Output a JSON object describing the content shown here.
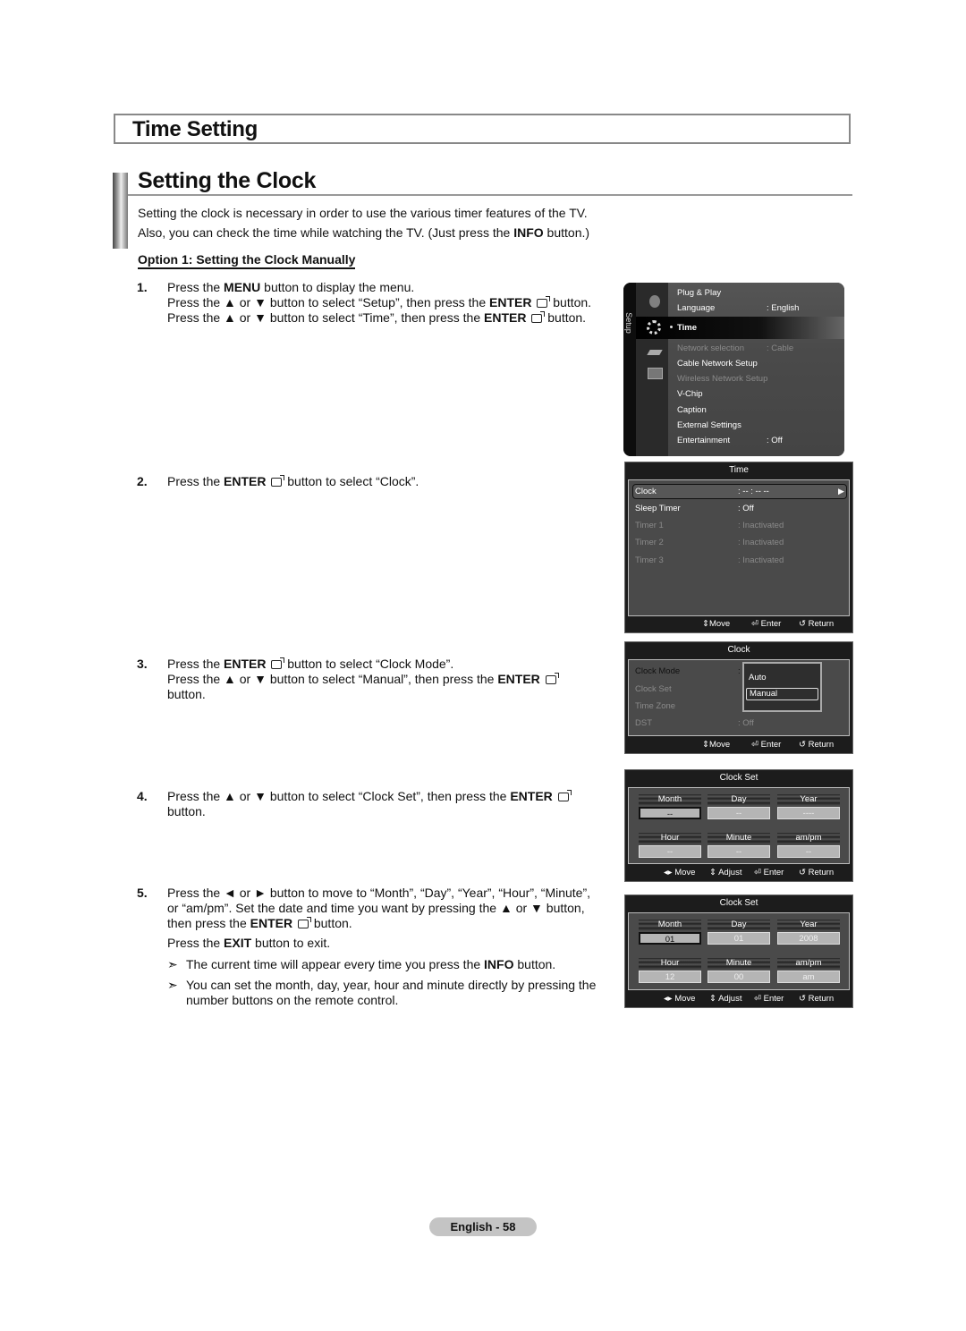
{
  "section_title": "Time Setting",
  "subsection_title": "Setting the Clock",
  "intro": [
    "Setting the clock is necessary in order to use the various timer features of the TV.",
    "Also, you can check the time while watching the TV. (Just press the INFO button.)"
  ],
  "option_heading": "Option 1: Setting the Clock Manually",
  "steps": [
    {
      "num": "1.",
      "lines": [
        "Press the MENU button to display the menu.",
        "Press the ▲ or ▼ button to select “Setup”, then press the ENTER button.",
        "Press the ▲ or ▼ button to select “Time”, then press the ENTER button."
      ]
    },
    {
      "num": "2.",
      "lines": [
        "Press the ENTER button to select “Clock”."
      ]
    },
    {
      "num": "3.",
      "lines": [
        "Press the ENTER button to select “Clock Mode”.",
        "Press the ▲ or ▼ button to select “Manual”, then press the ENTER",
        "button."
      ]
    },
    {
      "num": "4.",
      "lines": [
        "Press the ▲ or ▼ button to select “Clock Set”, then press the ENTER",
        "button."
      ]
    },
    {
      "num": "5.",
      "lines": [
        "Press the ◄ or ► button to move to “Month”, “Day”, “Year”, “Hour”, “Minute”,",
        "or “am/pm”. Set the date and time you want by pressing the ▲ or ▼ button,",
        "then press the ENTER button.",
        "Press the EXIT button to exit."
      ]
    }
  ],
  "notes": [
    "The current time will appear every time you press the INFO button.",
    "You can set the month, day, year, hour and minute directly by pressing the number buttons on the remote control."
  ],
  "setup_menu": {
    "side_label": "Setup",
    "items": [
      {
        "label": "Plug & Play",
        "value": "",
        "state": "normal"
      },
      {
        "label": "Language",
        "value": ": English",
        "state": "normal"
      },
      {
        "label": "Time",
        "value": "",
        "state": "selected"
      },
      {
        "label": "Network selection",
        "value": ": Cable",
        "state": "dim"
      },
      {
        "label": "Cable Network Setup",
        "value": "",
        "state": "normal"
      },
      {
        "label": "Wireless Network Setup",
        "value": "",
        "state": "dim"
      },
      {
        "label": "V-Chip",
        "value": "",
        "state": "normal"
      },
      {
        "label": "Caption",
        "value": "",
        "state": "normal"
      },
      {
        "label": "External Settings",
        "value": "",
        "state": "normal"
      },
      {
        "label": "Entertainment",
        "value": ": Off",
        "state": "normal"
      }
    ]
  },
  "time_menu": {
    "title": "Time",
    "items": [
      {
        "label": "Clock",
        "value": ": -- : -- --",
        "state": "selected"
      },
      {
        "label": "Sleep Timer",
        "value": ": Off",
        "state": "normal"
      },
      {
        "label": "Timer 1",
        "value": ": Inactivated",
        "state": "dim"
      },
      {
        "label": "Timer 2",
        "value": ": Inactivated",
        "state": "dim"
      },
      {
        "label": "Timer 3",
        "value": ": Inactivated",
        "state": "dim"
      }
    ],
    "footer": {
      "move": "Move",
      "enter": "Enter",
      "return": "Return"
    }
  },
  "clock_menu": {
    "title": "Clock",
    "items": [
      {
        "label": "Clock Mode",
        "value": ":",
        "state": "normal"
      },
      {
        "label": "Clock Set",
        "value": "",
        "state": "dim"
      },
      {
        "label": "Time Zone",
        "value": "",
        "state": "dim"
      },
      {
        "label": "DST",
        "value": ": Off",
        "state": "dim"
      }
    ],
    "dropdown": {
      "options": [
        "Auto",
        "Manual"
      ],
      "selected": "Manual"
    },
    "footer": {
      "move": "Move",
      "enter": "Enter",
      "return": "Return"
    }
  },
  "clock_set_empty": {
    "title": "Clock Set",
    "fields": [
      {
        "label": "Month",
        "value": "--"
      },
      {
        "label": "Day",
        "value": "--"
      },
      {
        "label": "Year",
        "value": "----"
      },
      {
        "label": "Hour",
        "value": "--"
      },
      {
        "label": "Minute",
        "value": "--"
      },
      {
        "label": "am/pm",
        "value": "--"
      }
    ],
    "footer": {
      "move": "Move",
      "adjust": "Adjust",
      "enter": "Enter",
      "return": "Return"
    }
  },
  "clock_set_filled": {
    "title": "Clock Set",
    "fields": [
      {
        "label": "Month",
        "value": "01"
      },
      {
        "label": "Day",
        "value": "01"
      },
      {
        "label": "Year",
        "value": "2008"
      },
      {
        "label": "Hour",
        "value": "12"
      },
      {
        "label": "Minute",
        "value": "00"
      },
      {
        "label": "am/pm",
        "value": "am"
      }
    ],
    "footer": {
      "move": "Move",
      "adjust": "Adjust",
      "enter": "Enter",
      "return": "Return"
    }
  },
  "page_label": "English - 58"
}
